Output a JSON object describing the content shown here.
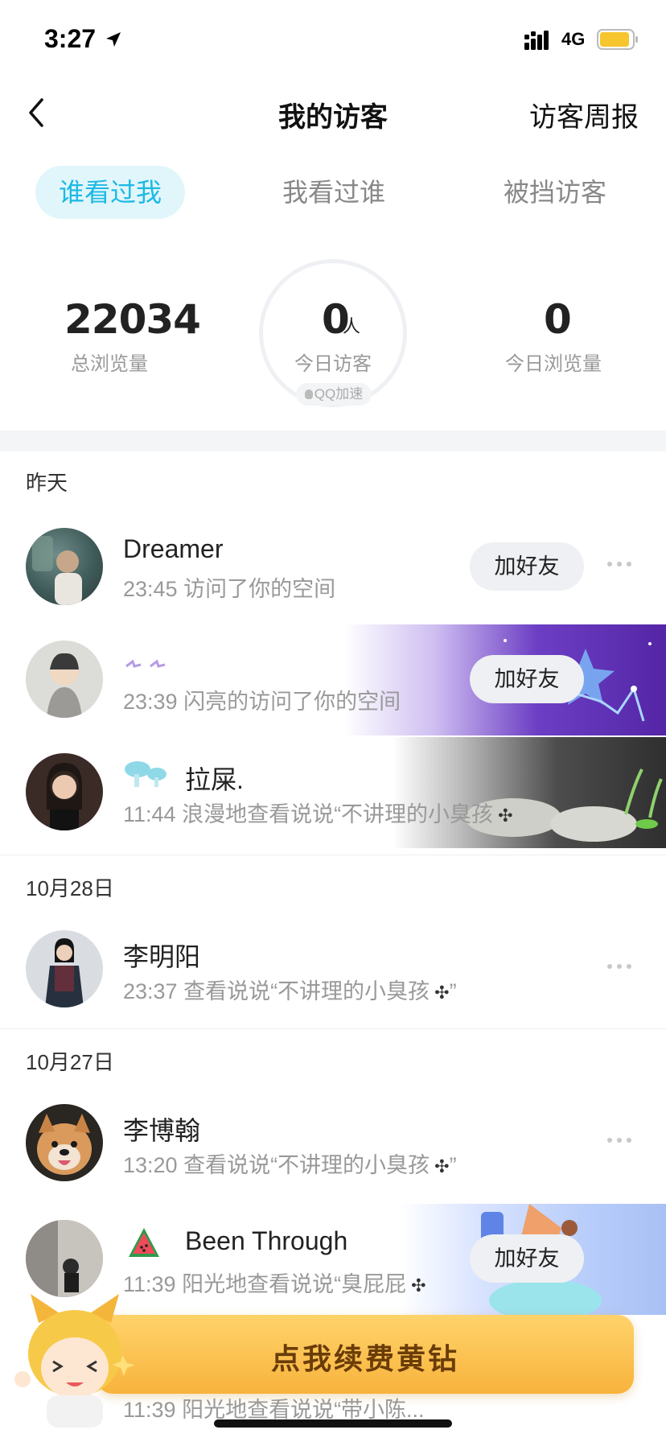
{
  "status_bar": {
    "time": "3:27",
    "network": "4G"
  },
  "nav": {
    "title": "我的访客",
    "right_link": "访客周报"
  },
  "tabs": [
    {
      "label": "谁看过我",
      "active": true
    },
    {
      "label": "我看过谁",
      "active": false
    },
    {
      "label": "被挡访客",
      "active": false
    }
  ],
  "stats": {
    "total_views": {
      "value": "22034",
      "label": "总浏览量"
    },
    "today_visitors": {
      "value": "0",
      "unit": "人",
      "label": "今日访客",
      "badge": "QQ加速"
    },
    "today_views": {
      "value": "0",
      "label": "今日浏览量"
    }
  },
  "sections": [
    {
      "header": "昨天"
    },
    {
      "header": "10月28日"
    },
    {
      "header": "10月27日"
    }
  ],
  "visitors": [
    {
      "name": "Dreamer",
      "desc": "23:45 访问了你的空间",
      "button": "加好友"
    },
    {
      "name": "",
      "desc": "23:39 闪亮的访问了你的空间",
      "button": "加好友"
    },
    {
      "name": "拉屎.",
      "desc": "11:44 浪漫地查看说说“不讲理的小臭孩"
    },
    {
      "name": "李明阳",
      "desc": "23:37 查看说说“不讲理的小臭孩",
      "desc_tail": "”"
    },
    {
      "name": "李博翰",
      "desc": "13:20 查看说说“不讲理的小臭孩",
      "desc_tail": "”"
    },
    {
      "name": "Been Through",
      "desc": "11:39 阳光地查看说说“臭屁屁",
      "button": "加好友"
    },
    {
      "name": "",
      "desc": "11:39 阳光地查看说说“带小陈..."
    }
  ],
  "promo": {
    "label": "点我续费黄钻"
  },
  "colors": {
    "accent": "#1cb9e4",
    "tab_active_bg": "#e1f6fb",
    "promo": "#f8b33c"
  }
}
